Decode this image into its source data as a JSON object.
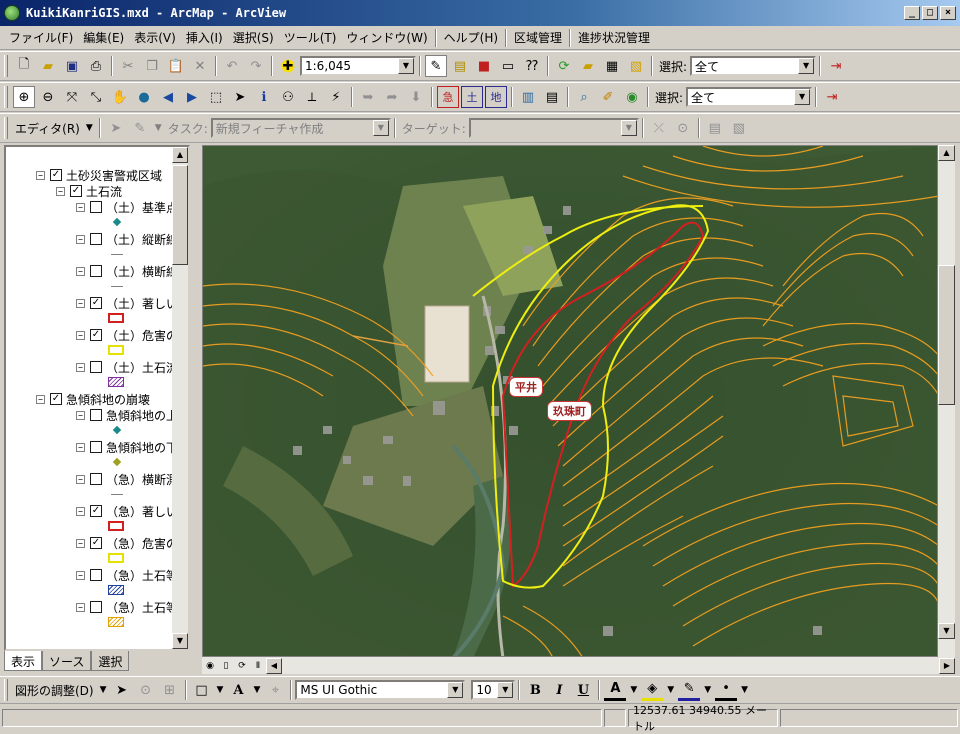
{
  "window": {
    "title": "KuikiKanriGIS.mxd - ArcMap - ArcView",
    "min": "_",
    "max": "□",
    "close": "×"
  },
  "menu": [
    "ファイル(F)",
    "編集(E)",
    "表示(V)",
    "挿入(I)",
    "選択(S)",
    "ツール(T)",
    "ウィンドウ(W)",
    "ヘルプ(H)",
    "区域管理",
    "進捗状況管理"
  ],
  "toolbar": {
    "scale": "1:6,045",
    "select_label": "選択:",
    "select_value": "全て",
    "select_label2": "選択:",
    "select_value2": "全て"
  },
  "editor": {
    "label": "エディタ(R)",
    "task_label": "タスク:",
    "task_value": "新規フィーチャ作成",
    "target_label": "ターゲット:",
    "target_value": ""
  },
  "toc": {
    "items": [
      {
        "label": "土砂災害警戒区域",
        "checked": true,
        "expanded": true
      },
      {
        "label": "土石流",
        "checked": true,
        "expanded": true
      },
      {
        "label": "（土）基準点",
        "checked": false
      },
      {
        "label": "（土）縦断線",
        "checked": false
      },
      {
        "label": "（土）横断線",
        "checked": false
      },
      {
        "label": "（土）著しい危",
        "checked": true
      },
      {
        "label": "（土）危害のお",
        "checked": true
      },
      {
        "label": "（土）土石流の",
        "checked": false
      },
      {
        "label": "急傾斜地の崩壊",
        "checked": true,
        "expanded": true
      },
      {
        "label": "急傾斜地の上",
        "checked": false
      },
      {
        "label": "急傾斜地の下",
        "checked": false
      },
      {
        "label": "（急）横断測線",
        "checked": false
      },
      {
        "label": "（急）著しい危",
        "checked": true
      },
      {
        "label": "（急）危害のお",
        "checked": true
      },
      {
        "label": "（急）土石等の",
        "checked": false
      },
      {
        "label": "（急）土石等の",
        "checked": false
      }
    ],
    "tabs": [
      "表示",
      "ソース",
      "選択"
    ]
  },
  "map": {
    "labels": [
      "平井",
      "玖珠町"
    ],
    "colors": {
      "contour": "#f0a020",
      "red": "#d22020",
      "yellow": "#f0f020"
    }
  },
  "drawbar": {
    "adjust": "図形の調整(D)",
    "font": "MS UI Gothic",
    "size": "10",
    "bold": "B",
    "italic": "I",
    "underline": "U"
  },
  "status": {
    "coords": "12537.61  34940.55 メートル"
  }
}
